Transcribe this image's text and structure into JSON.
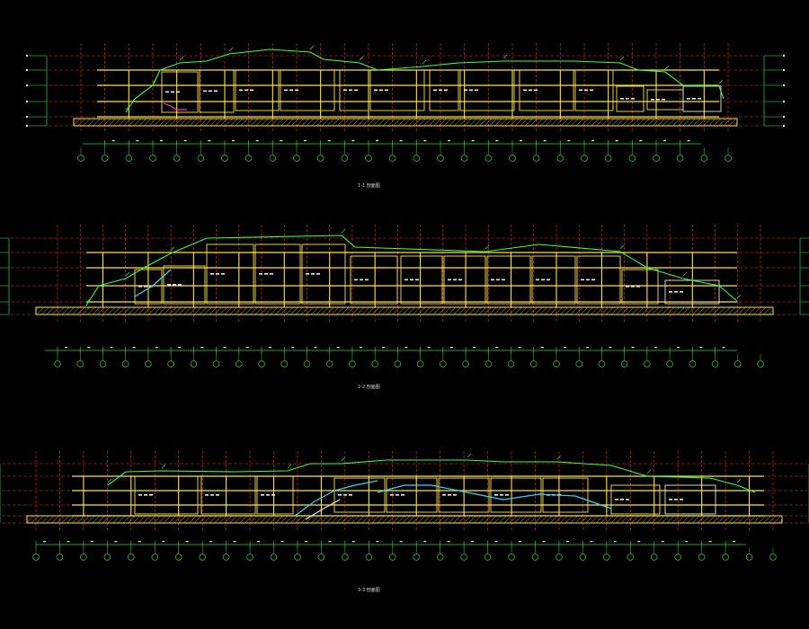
{
  "drawing": {
    "background": "#000000",
    "colors": {
      "grid_red": "#ff2a2a",
      "floor_yellow": "#ffe23a",
      "outline_green": "#39ff3a",
      "dimension_green": "#2bd62b",
      "detail_white": "#e8e8e8",
      "detail_cyan": "#33d6ff",
      "detail_magenta": "#ff33cc",
      "hatch_gold": "#c8b23a"
    },
    "sections": [
      {
        "id": "section-1",
        "caption": "1-1 剖面图"
      },
      {
        "id": "section-2",
        "caption": "2-2 剖面图"
      },
      {
        "id": "section-3",
        "caption": "3-3 剖面图"
      }
    ]
  }
}
